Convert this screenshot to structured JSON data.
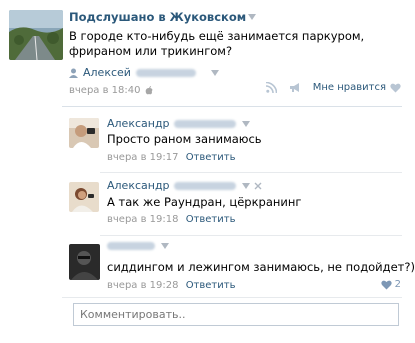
{
  "post": {
    "group_name": "Подслушано в Жуковском",
    "text": "В городе кто-нибудь ещё занимается паркуром, фрираном или трикингом?",
    "signer_first_name": "Алексей",
    "time": "вчера в 18:40",
    "like_label": "Мне нравится"
  },
  "comments": [
    {
      "author_first_name": "Александр",
      "text": "Просто раном занимаюсь",
      "time": "вчера в 19:17",
      "reply_label": "Ответить"
    },
    {
      "author_first_name": "Александр",
      "text": "А так же Раундран, цёркранинг",
      "time": "вчера в 19:18",
      "reply_label": "Ответить"
    },
    {
      "author_first_name": "",
      "text": "сиддингом и лежингом занимаюсь, не подойдет?)",
      "time": "вчера в 19:28",
      "reply_label": "Ответить",
      "likes": "2"
    }
  ],
  "comment_box": {
    "placeholder": "Комментировать.."
  },
  "colors": {
    "link": "#2b587a",
    "meta": "#999999",
    "accent_like": "#7d97b5"
  },
  "icons": [
    "apple-icon",
    "rss-icon",
    "megaphone-icon",
    "heart-icon",
    "caret-down-icon"
  ]
}
